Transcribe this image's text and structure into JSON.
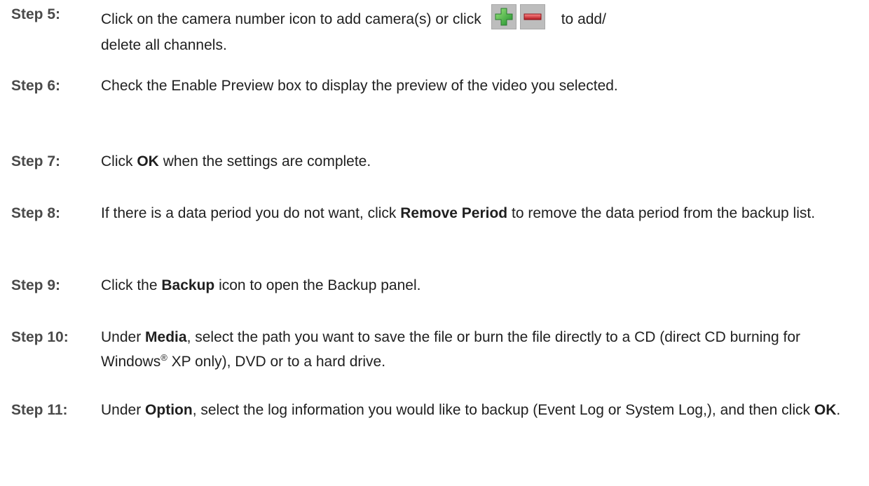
{
  "steps": [
    {
      "label": "Step 5:",
      "before_icons": "Click on the camera number icon to add camera(s) or click",
      "add_icon": "plus-icon",
      "delete_icon": "minus-icon",
      "after_icons_1": "to add/",
      "after_icons_2": "delete all channels."
    },
    {
      "label": "Step 6:",
      "text": "Check the Enable Preview box to display the preview of the video you selected."
    },
    {
      "label": "Step 7:",
      "t1": "Click",
      "b1": "OK",
      "t2": "when the settings are complete."
    },
    {
      "label": "Step 8:",
      "t1": "If there is a data period you do not want, click",
      "b1": "Remove Period",
      "t2": "to remove the data period from the backup list."
    },
    {
      "label": "Step 9:",
      "t1": "Click the",
      "b1": "Backup",
      "t2": "icon to open the Backup panel."
    },
    {
      "label": "Step 10:",
      "t1": "Under",
      "b1": "Media",
      "t2": ", select the path you want to save the file or burn the file directly to a CD (direct CD burning for Windows",
      "reg": "®",
      "t3": "XP only), DVD or to a hard drive."
    },
    {
      "label": "Step 11:",
      "t1": "Under",
      "b1": "Option",
      "t2": ", select the log information you would like to backup (Event Log or System Log,), and then click",
      "b2": "OK",
      "t3": "."
    }
  ],
  "colors": {
    "label": "#4a4a4a",
    "text": "#1f1f1f",
    "add_icon_green": "#3cb54a",
    "delete_icon_red": "#d9262e",
    "icon_button_bg": "#bdbdbd"
  }
}
